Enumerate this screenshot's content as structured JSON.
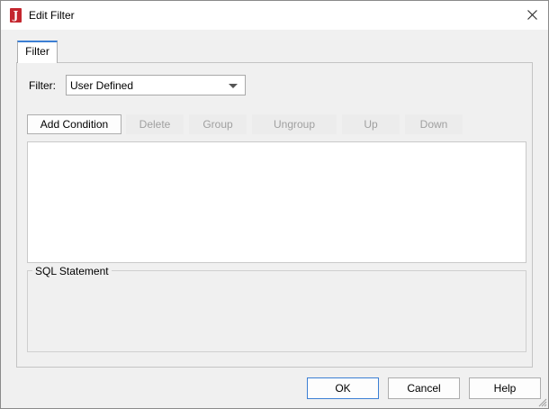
{
  "window": {
    "title": "Edit Filter",
    "app_icon_letter": "J",
    "app_icon_color": "#c4262e"
  },
  "tabs": [
    {
      "label": "Filter",
      "active": true
    }
  ],
  "filter": {
    "label": "Filter:",
    "selected": "User Defined"
  },
  "toolbar": {
    "buttons": [
      {
        "label": "Add Condition",
        "enabled": true
      },
      {
        "label": "Delete",
        "enabled": false
      },
      {
        "label": "Group",
        "enabled": false
      },
      {
        "label": "Ungroup",
        "enabled": false
      },
      {
        "label": "Up",
        "enabled": false
      },
      {
        "label": "Down",
        "enabled": false
      }
    ]
  },
  "sql": {
    "legend": "SQL Statement",
    "text": ""
  },
  "footer": {
    "ok_label": "OK",
    "cancel_label": "Cancel",
    "help_label": "Help"
  },
  "colors": {
    "accent": "#3c7fd4",
    "dialog_bg": "#f0f0f0"
  }
}
